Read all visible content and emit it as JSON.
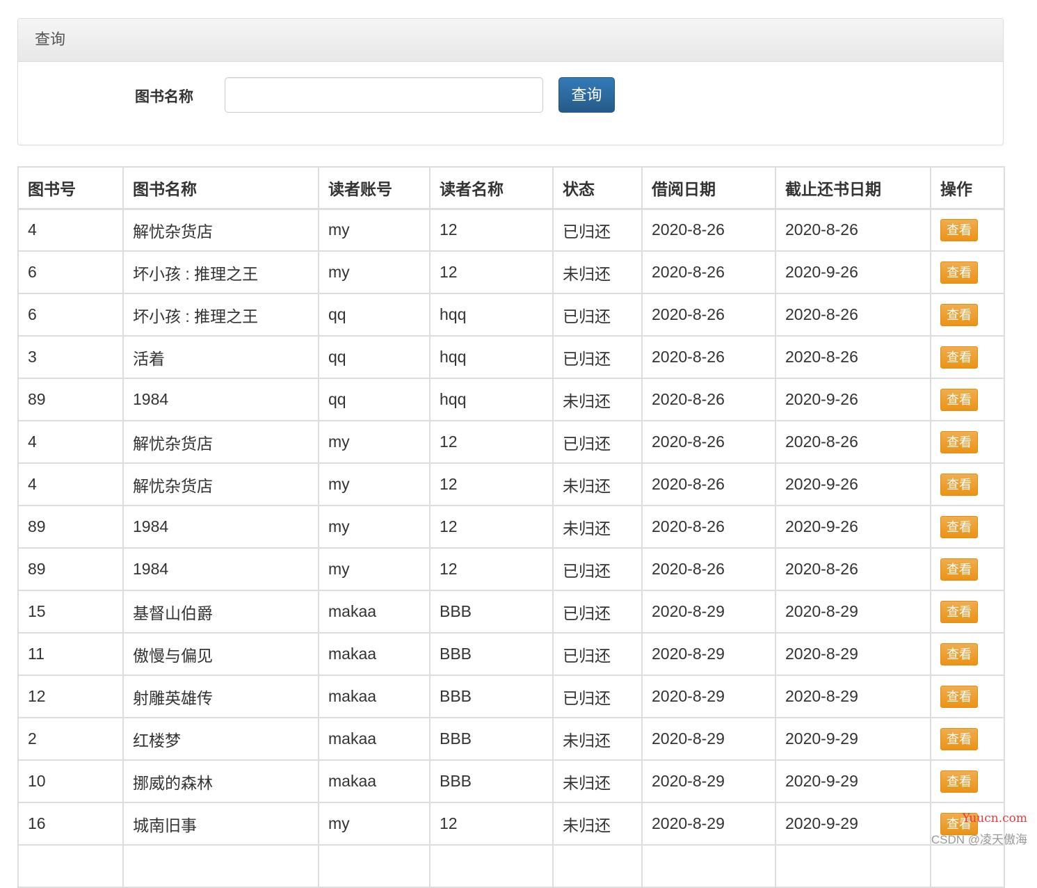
{
  "search_panel": {
    "title": "查询",
    "field_label": "图书名称",
    "input_value": "",
    "input_placeholder": "",
    "button_label": "查询"
  },
  "table": {
    "headers": [
      "图书号",
      "图书名称",
      "读者账号",
      "读者名称",
      "状态",
      "借阅日期",
      "截止还书日期",
      "操作"
    ],
    "action_label": "查看",
    "rows": [
      {
        "book_id": "4",
        "book_name": "解忧杂货店",
        "reader_account": "my",
        "reader_name": "12",
        "status": "已归还",
        "borrow_date": "2020-8-26",
        "due_date": "2020-8-26"
      },
      {
        "book_id": "6",
        "book_name": "坏小孩 : 推理之王",
        "reader_account": "my",
        "reader_name": "12",
        "status": "未归还",
        "borrow_date": "2020-8-26",
        "due_date": "2020-9-26"
      },
      {
        "book_id": "6",
        "book_name": "坏小孩 : 推理之王",
        "reader_account": "qq",
        "reader_name": "hqq",
        "status": "已归还",
        "borrow_date": "2020-8-26",
        "due_date": "2020-8-26"
      },
      {
        "book_id": "3",
        "book_name": "活着",
        "reader_account": "qq",
        "reader_name": "hqq",
        "status": "已归还",
        "borrow_date": "2020-8-26",
        "due_date": "2020-8-26"
      },
      {
        "book_id": "89",
        "book_name": "1984",
        "reader_account": "qq",
        "reader_name": "hqq",
        "status": "未归还",
        "borrow_date": "2020-8-26",
        "due_date": "2020-9-26"
      },
      {
        "book_id": "4",
        "book_name": "解忧杂货店",
        "reader_account": "my",
        "reader_name": "12",
        "status": "已归还",
        "borrow_date": "2020-8-26",
        "due_date": "2020-8-26"
      },
      {
        "book_id": "4",
        "book_name": "解忧杂货店",
        "reader_account": "my",
        "reader_name": "12",
        "status": "未归还",
        "borrow_date": "2020-8-26",
        "due_date": "2020-9-26"
      },
      {
        "book_id": "89",
        "book_name": "1984",
        "reader_account": "my",
        "reader_name": "12",
        "status": "未归还",
        "borrow_date": "2020-8-26",
        "due_date": "2020-9-26"
      },
      {
        "book_id": "89",
        "book_name": "1984",
        "reader_account": "my",
        "reader_name": "12",
        "status": "已归还",
        "borrow_date": "2020-8-26",
        "due_date": "2020-8-26"
      },
      {
        "book_id": "15",
        "book_name": "基督山伯爵",
        "reader_account": "makaa",
        "reader_name": "BBB",
        "status": "已归还",
        "borrow_date": "2020-8-29",
        "due_date": "2020-8-29"
      },
      {
        "book_id": "11",
        "book_name": "傲慢与偏见",
        "reader_account": "makaa",
        "reader_name": "BBB",
        "status": "已归还",
        "borrow_date": "2020-8-29",
        "due_date": "2020-8-29"
      },
      {
        "book_id": "12",
        "book_name": "射雕英雄传",
        "reader_account": "makaa",
        "reader_name": "BBB",
        "status": "已归还",
        "borrow_date": "2020-8-29",
        "due_date": "2020-8-29"
      },
      {
        "book_id": "2",
        "book_name": "红楼梦",
        "reader_account": "makaa",
        "reader_name": "BBB",
        "status": "未归还",
        "borrow_date": "2020-8-29",
        "due_date": "2020-9-29"
      },
      {
        "book_id": "10",
        "book_name": "挪威的森林",
        "reader_account": "makaa",
        "reader_name": "BBB",
        "status": "未归还",
        "borrow_date": "2020-8-29",
        "due_date": "2020-9-29"
      },
      {
        "book_id": "16",
        "book_name": "城南旧事",
        "reader_account": "my",
        "reader_name": "12",
        "status": "未归还",
        "borrow_date": "2020-8-29",
        "due_date": "2020-9-29"
      },
      {
        "book_id": "",
        "book_name": "",
        "reader_account": "",
        "reader_name": "",
        "status": "",
        "borrow_date": "",
        "due_date": ""
      }
    ]
  },
  "watermark": {
    "brand": "Yuucn.com",
    "credit": "CSDN @凌天傲海"
  },
  "colors": {
    "primary": "#337ab7",
    "warning": "#f0ad4e",
    "border": "#dddddd"
  }
}
